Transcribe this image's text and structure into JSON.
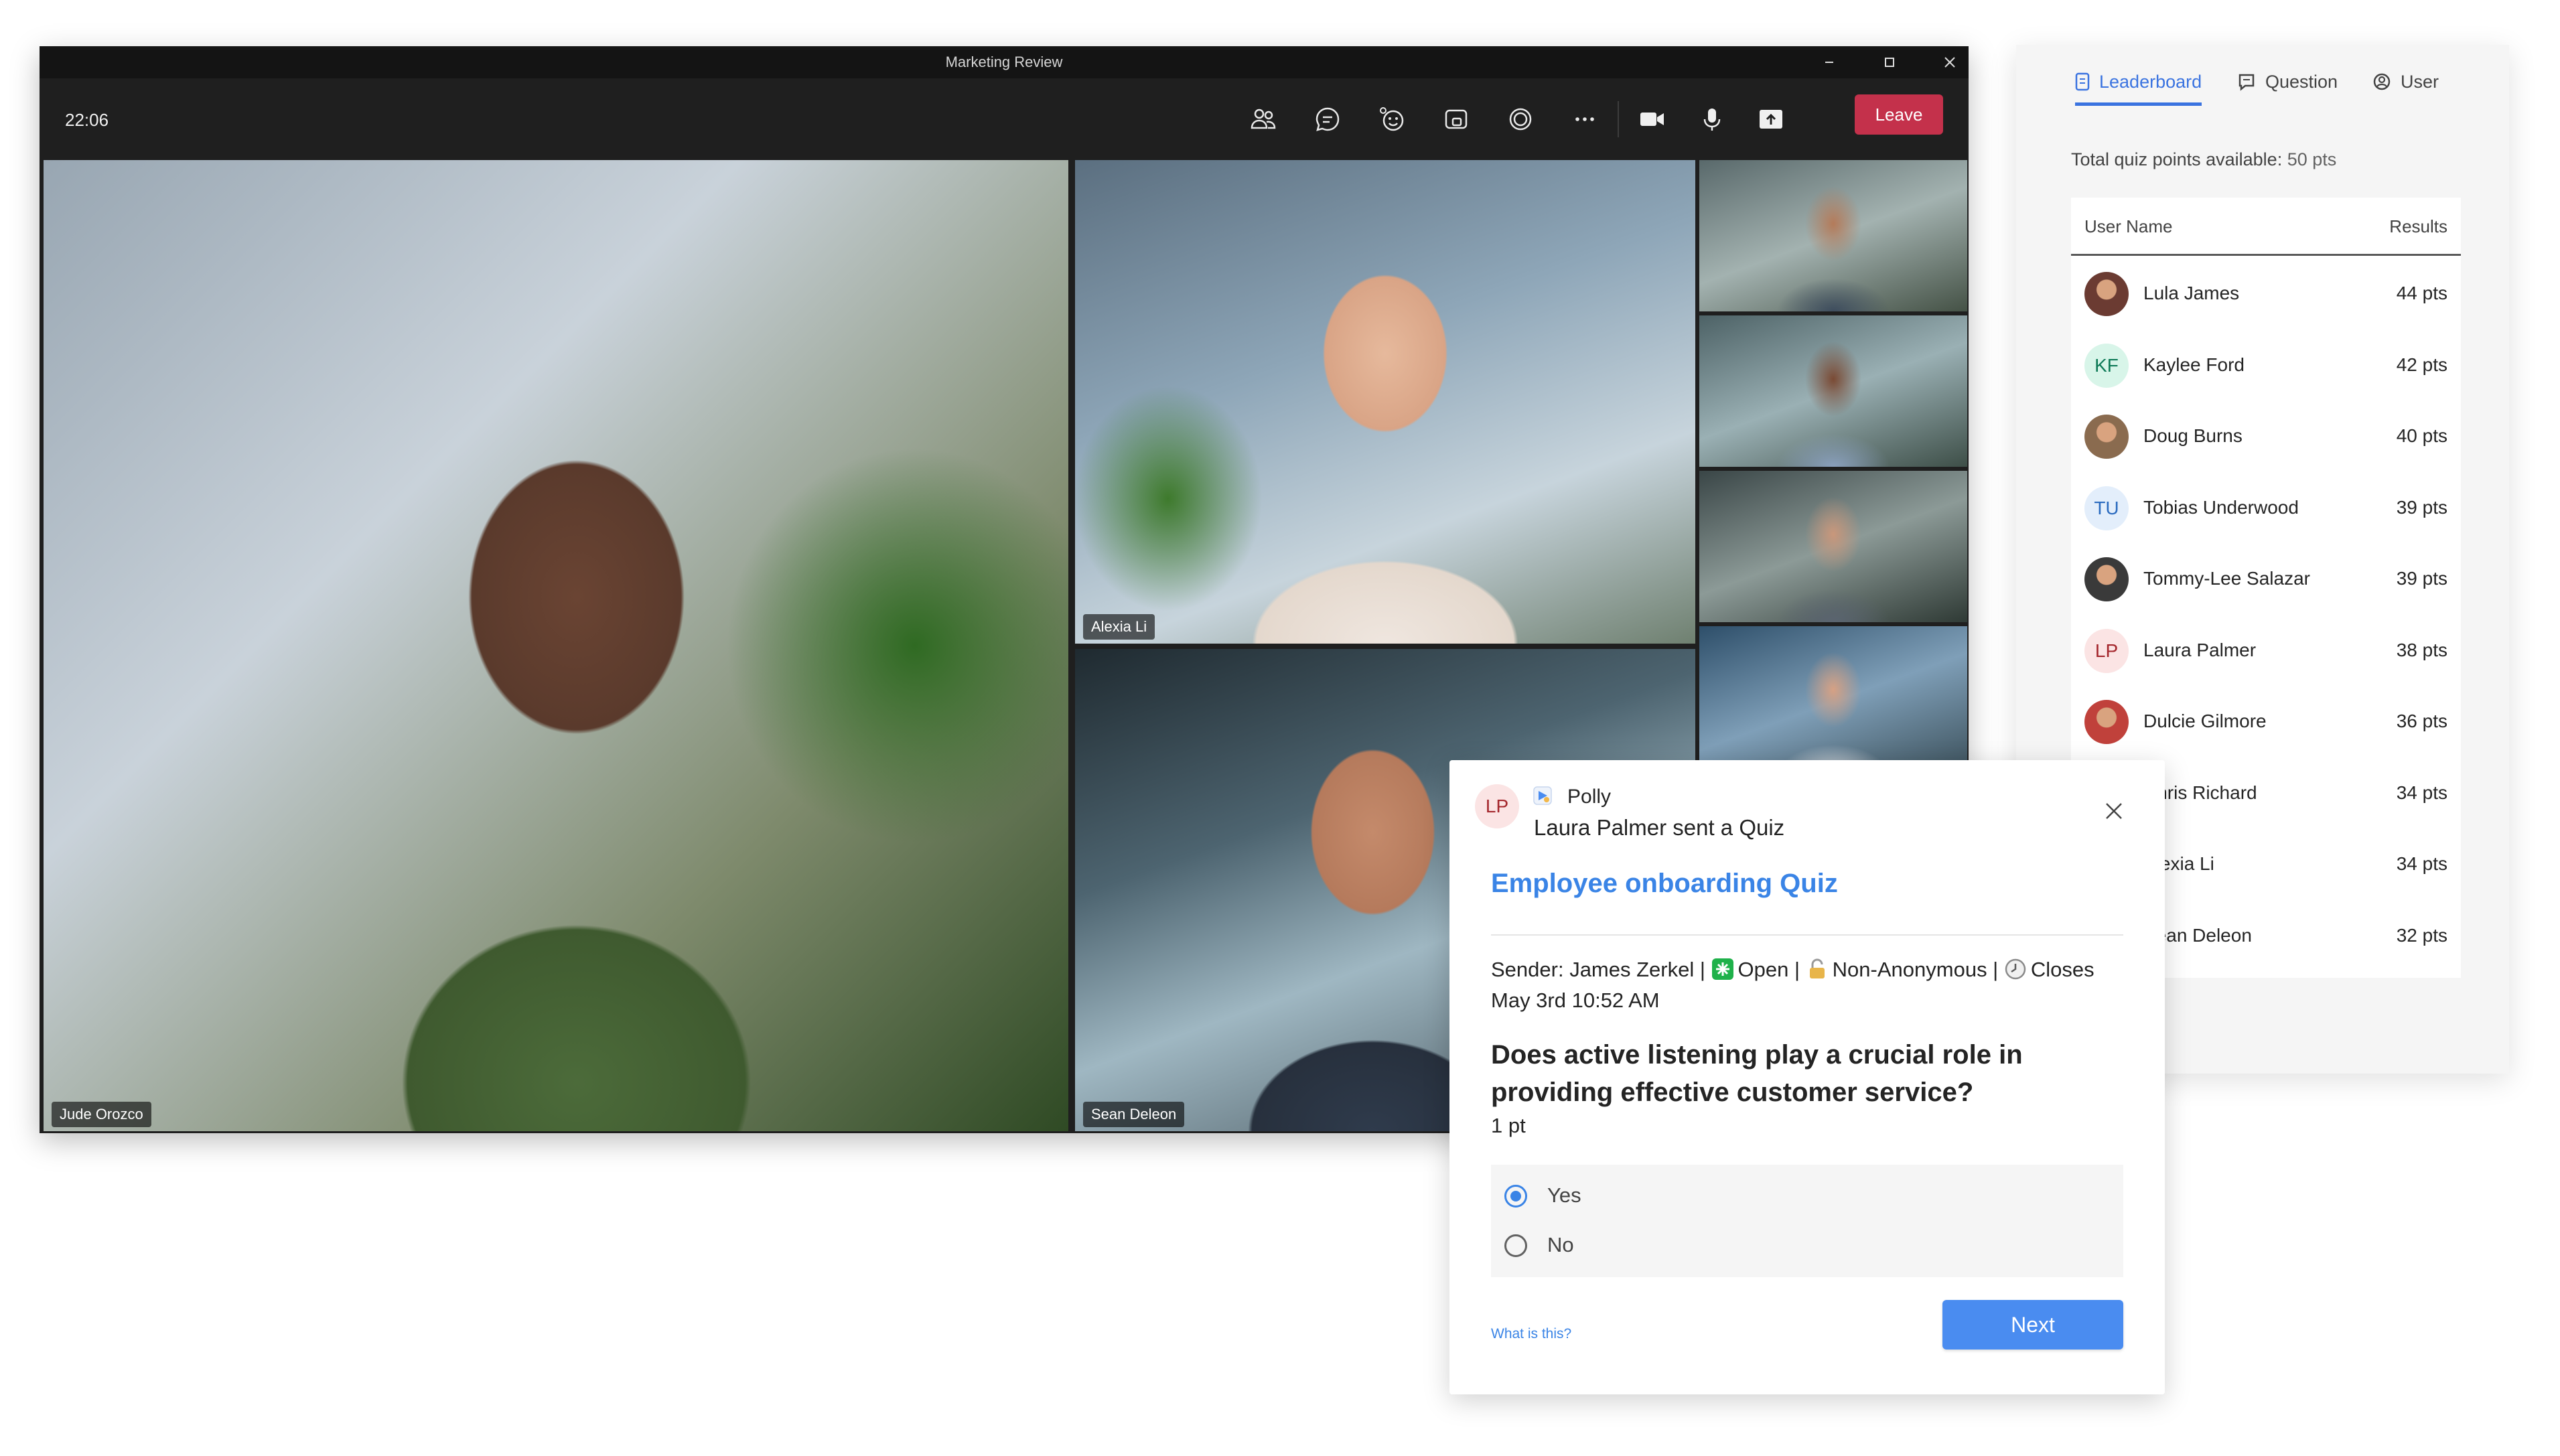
{
  "meeting": {
    "window_title": "Marketing Review",
    "clock": "22:06",
    "leave_label": "Leave",
    "toolbar_icons": [
      "people-icon",
      "chat-icon",
      "react-icon",
      "rooms-icon",
      "apps-icon",
      "more-icon",
      "camera-icon",
      "mic-icon",
      "share-icon"
    ],
    "participants": [
      {
        "name": "Jude Orozco"
      },
      {
        "name": "Alexia Li"
      },
      {
        "name": "Sean Deleon"
      }
    ]
  },
  "leaderboard": {
    "tabs": [
      {
        "label": "Leaderboard",
        "active": true
      },
      {
        "label": "Question",
        "active": false
      },
      {
        "label": "User",
        "active": false
      }
    ],
    "total_label": "Total quiz points available:",
    "total_value": "50 pts",
    "columns": {
      "user": "User Name",
      "results": "Results"
    },
    "rows": [
      {
        "name": "Lula James",
        "points": "44 pts",
        "initials": "",
        "avatar_color": "#6b3b32"
      },
      {
        "name": "Kaylee Ford",
        "points": "42 pts",
        "initials": "KF",
        "avatar_color": "#d8f5e9"
      },
      {
        "name": "Doug Burns",
        "points": "40 pts",
        "initials": "",
        "avatar_color": "#8a6b4f"
      },
      {
        "name": "Tobias Underwood",
        "points": "39 pts",
        "initials": "TU",
        "avatar_color": "#e3eefb"
      },
      {
        "name": "Tommy-Lee Salazar",
        "points": "39 pts",
        "initials": "",
        "avatar_color": "#3a3a3a"
      },
      {
        "name": "Laura Palmer",
        "points": "38 pts",
        "initials": "LP",
        "avatar_color": "#fbe4e4"
      },
      {
        "name": "Dulcie Gilmore",
        "points": "36 pts",
        "initials": "",
        "avatar_color": "#c0413b"
      },
      {
        "name": "Chris Richard",
        "points": "34 pts",
        "initials": "",
        "avatar_color": "#777777"
      },
      {
        "name": "Alexia Li",
        "points": "34 pts",
        "initials": "",
        "avatar_color": "#777777"
      },
      {
        "name": "Sean Deleon",
        "points": "32 pts",
        "initials": "",
        "avatar_color": "#777777"
      }
    ]
  },
  "quiz": {
    "sender_initials": "LP",
    "app_name": "Polly",
    "subtitle": "Laura Palmer sent a Quiz",
    "title": "Employee onboarding Quiz",
    "sender": "Sender: James Zerkel |",
    "status_open": "Open |",
    "status_anon": "Non-Anonymous |",
    "closes": "Closes May 3rd 10:52 AM",
    "question": "Does active listening play a crucial role in providing effective customer service?",
    "points": "1 pt",
    "options": [
      {
        "label": "Yes",
        "selected": true
      },
      {
        "label": "No",
        "selected": false
      }
    ],
    "help_link": "What is this?",
    "next_label": "Next"
  },
  "colors": {
    "accent": "#3a84e6",
    "leave": "#c4314b",
    "toolbar_bg": "#1f1f1f"
  }
}
